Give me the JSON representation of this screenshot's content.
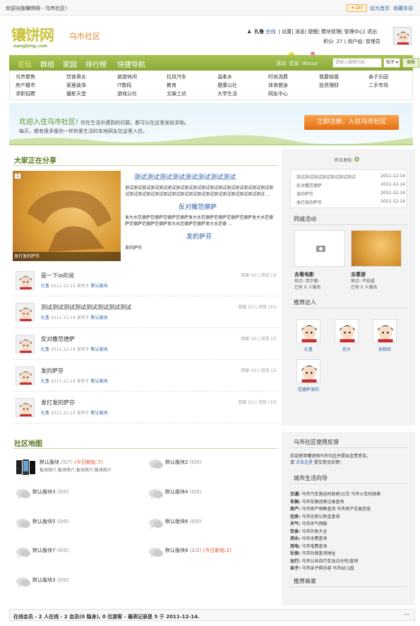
{
  "topbar": {
    "welcome": "欢迎光临镶饼网 - 乌市社区!",
    "diy": "DIY",
    "home": "设为首页",
    "fav": "收藏本站"
  },
  "logo": {
    "name": "镶饼网",
    "domain": "nangbing.com",
    "subtitle": "乌市社区"
  },
  "user": {
    "name": "扎鲁",
    "status": "在线",
    "links": [
      "设置",
      "消息",
      "提醒",
      "模块管理",
      "管理中心",
      "退出"
    ],
    "points": "积分: 27",
    "group": "用户组: 管理员"
  },
  "nav": {
    "items": [
      "论坛",
      "群组",
      "家园",
      "排行榜",
      "快捷导航"
    ],
    "links": [
      "活动",
      "交友",
      "discuz"
    ],
    "search_placeholder": "请输入搜索内容",
    "search_select": "帖子",
    "search_button": "搜索"
  },
  "subnav": [
    [
      "乌市聚焦",
      "饮食男女",
      "旅游休闲",
      "拉风汽车",
      "温柔乡",
      "时尚消费",
      "我要结婚",
      "亲子乐园"
    ],
    [
      "房产楼市",
      "家居装饰",
      "IT数码",
      "教育",
      "健康公社",
      "体育健身",
      "投资理财",
      "二手市场"
    ],
    [
      "求职招聘",
      "摄影天堂",
      "游戏公社",
      "文娱工坊",
      "大学生活",
      "网友中心"
    ]
  ],
  "banner": {
    "title": "欢迎入住乌市社区!",
    "title_note": "你在生活中遇到的问题，都可以在这里发帖求助。",
    "line2": "每天，都有很多像你一样热爱生活的本地网友在这里入住。",
    "cta": "立即注册，入住乌市社区"
  },
  "sharing": {
    "title": "大家正在分享",
    "feature": {
      "num": "1",
      "caption": "发打发的萨芬",
      "headline": "测试测试测试测试测试测试测试测试",
      "p1": "测试测试测试测试测试测试测试测试测试测试测试测试测试测试测试测试测试测试测试测试测试测试测试测试测试测试测试测试测试测试测试测试测试测试 ...",
      "h2": "反对撒范德萨",
      "p2": "发大水范德萨范德萨范德萨范德萨发大水范德萨范德萨范德萨范德萨发大水范德萨范德萨范德萨范德萨发大水范德萨范德萨发大水范德 ...",
      "h3": "发的萨芬",
      "p3": "发的萨芬"
    },
    "posts": [
      {
        "title": "是一下ie的说",
        "author": "扎鲁",
        "date": "2011-12-14 发布于",
        "board": "默认版块",
        "counts": "回复 (0) | 浏览 (3)"
      },
      {
        "title": "测试测试测试测试测试测试测试测试",
        "author": "扎鲁",
        "date": "2011-12-14 发布于",
        "board": "默认版块",
        "counts": "回复 (1) | 浏览 (31)"
      },
      {
        "title": "反对撒范德萨",
        "author": "扎鲁",
        "date": "2011-12-14 发布于",
        "board": "默认版块",
        "counts": "回复 (0) | 浏览 (2)"
      },
      {
        "title": "发的萨芬",
        "author": "扎鲁",
        "date": "2011-12-14 发布于",
        "board": "默认版块",
        "counts": "回复 (0) | 浏览 (2)"
      },
      {
        "title": "发打发的萨芬",
        "author": "扎鲁",
        "date": "2011-12-14 发布于",
        "board": "默认版块",
        "counts": "回复 (1) | 浏览 (33)"
      }
    ]
  },
  "right": {
    "yesterday": "昨日发帖:",
    "yesterday_count": "0",
    "recent": [
      {
        "title": "测试测试测试测试测试测试测试",
        "date": "2011-12-14"
      },
      {
        "title": "反对撒范德萨",
        "date": "2011-12-14"
      },
      {
        "title": "发的萨芬",
        "date": "2011-12-14"
      },
      {
        "title": "发打发的萨芬",
        "date": "2011-12-14"
      }
    ],
    "activity_title": "同城活动",
    "activities": [
      {
        "name": "去看电影",
        "place": "地点: 库尔勒",
        "count": "已有 0 人报名"
      },
      {
        "name": "去春游",
        "place": "地点: 不知道",
        "count": "已有 0 人报名"
      }
    ],
    "members_title": "推荐达人",
    "members": [
      "扎鲁",
      "扰大",
      "会相后",
      "范德萨发的"
    ]
  },
  "map": {
    "title": "社区地图",
    "boards": [
      {
        "name": "默认版块",
        "count": "(5/7)",
        "today": "(今日新帖:7)",
        "desc": "板块简介,板块简介,板块简介,板块简介"
      },
      {
        "name": "默认版块2",
        "count": "(0/0)",
        "today": "",
        "desc": ""
      },
      {
        "name": "默认版块3",
        "count": "(0/0)",
        "today": "",
        "desc": ""
      },
      {
        "name": "默认版块4",
        "count": "(0/0)",
        "today": "",
        "desc": ""
      },
      {
        "name": "默认版块5",
        "count": "(0/0)",
        "today": "",
        "desc": ""
      },
      {
        "name": "默认版块6",
        "count": "(0/0)",
        "today": "",
        "desc": ""
      },
      {
        "name": "默认版块7",
        "count": "(0/0)",
        "today": "",
        "desc": ""
      },
      {
        "name": "默认版块8",
        "count": "(2/2)",
        "today": "(今日新帖:2)",
        "desc": ""
      },
      {
        "name": "默认版块3",
        "count": "(0/0)",
        "today": "",
        "desc": ""
      }
    ]
  },
  "feedback": {
    "title": "乌市社区使用反馈",
    "line1": "欢迎使用镶饼网乌市社区并提出宝贵意见。",
    "line2_pre": "请",
    "line2_link": "点击这里",
    "line2_post": "提交意见反馈!"
  },
  "guide": {
    "title": "城市生活向导",
    "rows": [
      {
        "label": "交通:",
        "text": "乌市汽车营运时刻表|公交  乌市火车时刻表"
      },
      {
        "label": "车辆:",
        "text": "乌市车辆违章记录查询"
      },
      {
        "label": "房产:",
        "text": "乌市房产销售查询  乌市房产交易信息"
      },
      {
        "label": "住房:",
        "text": "乌市住房公积金查询"
      },
      {
        "label": "天气:",
        "text": "乌市天气预报"
      },
      {
        "label": "饮食:",
        "text": "乌市外卖大全"
      },
      {
        "label": "用水:",
        "text": "乌市水费查询"
      },
      {
        "label": "用电:",
        "text": "乌市电费查询"
      },
      {
        "label": "社保:",
        "text": "乌市社保查询地址"
      },
      {
        "label": "出行:",
        "text": "乌市公共自行车站点分布|查询"
      },
      {
        "label": "亲子:",
        "text": "乌市亲子俱乐部  乌市幼儿园"
      }
    ],
    "merchant_title": "推荐商家"
  },
  "footer": {
    "text": "在线会员 - 2 人在线 - 2 会员(0 隐身), 0 位游客 - 最高记录是 5 于 2011-12-14.",
    "collapse": "—"
  }
}
